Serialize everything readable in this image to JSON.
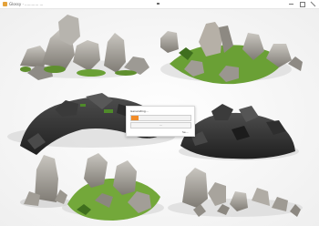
{
  "window": {
    "title": "Glossy · ............ ...",
    "accent": "#e4a23a",
    "controls": [
      "minimize-icon",
      "maximize-icon",
      "close-icon"
    ]
  },
  "dialog": {
    "message": "Generating...",
    "progress": 0.12,
    "progress_color": "#f28c28",
    "button_label": "...",
    "link_label": "Se..."
  }
}
